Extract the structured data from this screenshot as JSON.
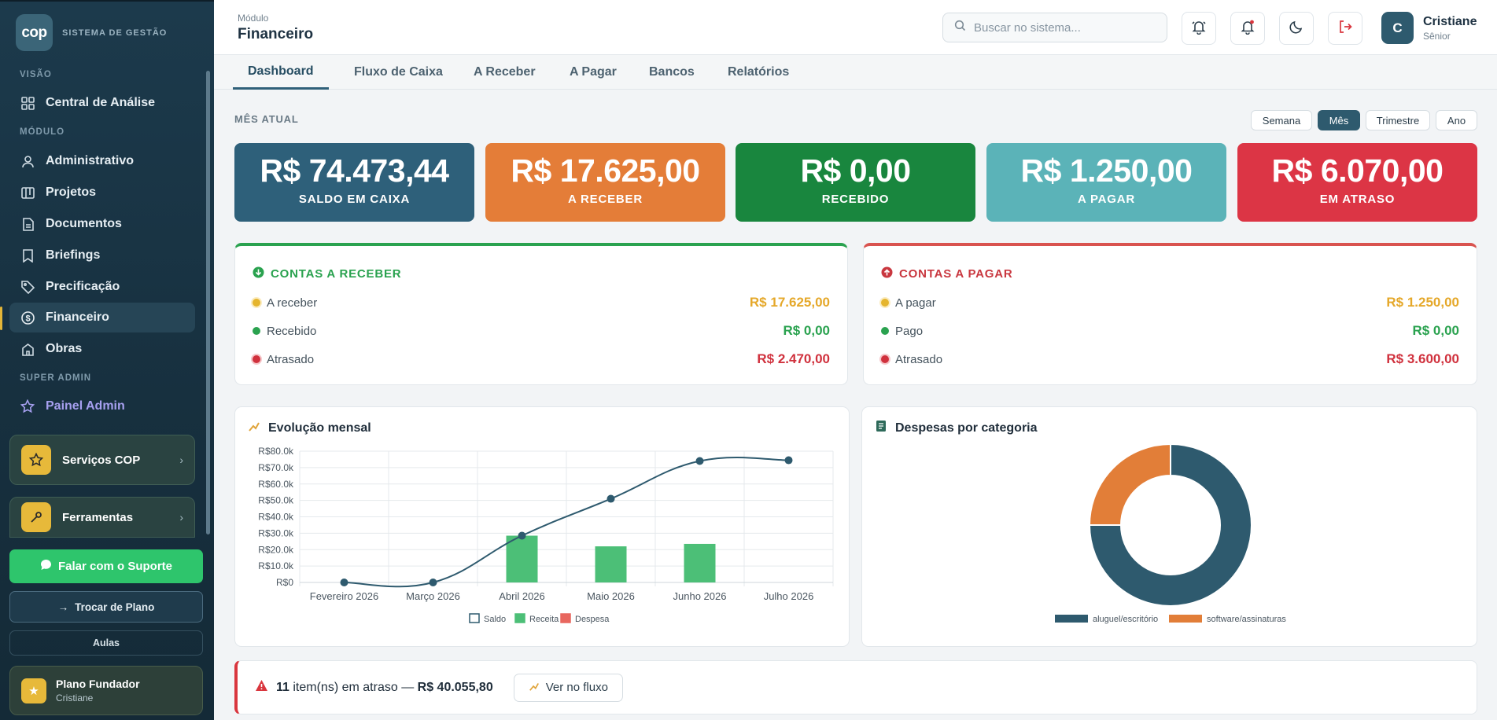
{
  "sidebar": {
    "logo": "cop",
    "brand": "SISTEMA DE GESTÃO",
    "sections": {
      "visao": "VISÃO",
      "modulo": "MÓDULO",
      "superadmin": "SUPER ADMIN"
    },
    "items": {
      "central": "Central de Análise",
      "administrativo": "Administrativo",
      "projetos": "Projetos",
      "documentos": "Documentos",
      "briefings": "Briefings",
      "precificacao": "Precificação",
      "financeiro": "Financeiro",
      "obras": "Obras",
      "painel": "Painel Admin"
    },
    "active": "Financeiro",
    "cards": {
      "servicos": "Serviços COP",
      "ferramentas": "Ferramentas"
    },
    "support": "Falar com o Suporte",
    "change_plan": "Trocar de Plano",
    "aulas": "Aulas",
    "plan": {
      "name": "Plano Fundador",
      "user": "Cristiane"
    }
  },
  "header": {
    "module_label": "Módulo",
    "module_name": "Financeiro",
    "search_placeholder": "Buscar no sistema...",
    "user": {
      "initial": "C",
      "name": "Cristiane",
      "role": "Sênior"
    }
  },
  "tabs": [
    "Dashboard",
    "Fluxo de Caixa",
    "A Receber",
    "A Pagar",
    "Bancos",
    "Relatórios"
  ],
  "active_tab": "Dashboard",
  "period": {
    "label": "MÊS ATUAL",
    "options": [
      "Semana",
      "Mês",
      "Trimestre",
      "Ano"
    ],
    "selected": "Mês"
  },
  "kpis": [
    {
      "value": "R$ 74.473,44",
      "label": "SALDO EM CAIXA",
      "color": "#2e607a"
    },
    {
      "value": "R$ 17.625,00",
      "label": "A RECEBER",
      "color": "#e47d38"
    },
    {
      "value": "R$ 0,00",
      "label": "RECEBIDO",
      "color": "#19863e"
    },
    {
      "value": "R$ 1.250,00",
      "label": "A PAGAR",
      "color": "#5bb3b8"
    },
    {
      "value": "R$ 6.070,00",
      "label": "EM ATRASO",
      "color": "#dc3545"
    }
  ],
  "receber": {
    "title": "CONTAS A RECEBER",
    "rows": [
      {
        "label": "A receber",
        "value": "R$ 17.625,00"
      },
      {
        "label": "Recebido",
        "value": "R$ 0,00"
      },
      {
        "label": "Atrasado",
        "value": "R$ 2.470,00"
      }
    ]
  },
  "pagar": {
    "title": "CONTAS A PAGAR",
    "rows": [
      {
        "label": "A pagar",
        "value": "R$ 1.250,00"
      },
      {
        "label": "Pago",
        "value": "R$ 0,00"
      },
      {
        "label": "Atrasado",
        "value": "R$ 3.600,00"
      }
    ]
  },
  "colors": {
    "yellow": "#e5a82a",
    "green": "#2aa24f",
    "red": "#d0313d",
    "saldo": "#2e5a6e",
    "receita": "#4cbf77",
    "despesa": "#e8675f",
    "orange": "#e27e38"
  },
  "chart_data": [
    {
      "type": "bar",
      "title": "Evolução mensal",
      "categories": [
        "Fevereiro 2026",
        "Março 2026",
        "Abril 2026",
        "Maio 2026",
        "Junho 2026",
        "Julho 2026"
      ],
      "ylim": [
        0,
        80000
      ],
      "y_ticks": [
        "R$0",
        "R$10.0k",
        "R$20.0k",
        "R$30.0k",
        "R$40.0k",
        "R$50.0k",
        "R$60.0k",
        "R$70.0k",
        "R$80.0k"
      ],
      "series": [
        {
          "name": "Saldo",
          "kind": "line",
          "values": [
            0,
            0,
            28500,
            51000,
            74000,
            74473
          ]
        },
        {
          "name": "Receita",
          "kind": "bar",
          "values": [
            0,
            0,
            28500,
            22000,
            23500,
            0
          ]
        },
        {
          "name": "Despesa",
          "kind": "bar",
          "values": [
            0,
            0,
            0,
            0,
            0,
            0
          ]
        }
      ],
      "legend": "bottom",
      "grid": true
    },
    {
      "type": "pie",
      "title": "Despesas por categoria",
      "categories": [
        "aluguel/escritório",
        "software/assinaturas"
      ],
      "values": [
        75,
        25
      ],
      "legend": "bottom"
    }
  ],
  "alert": {
    "count": "11",
    "text": "item(ns) em atraso —",
    "amount": "R$ 40.055,80",
    "button": "Ver no fluxo"
  }
}
